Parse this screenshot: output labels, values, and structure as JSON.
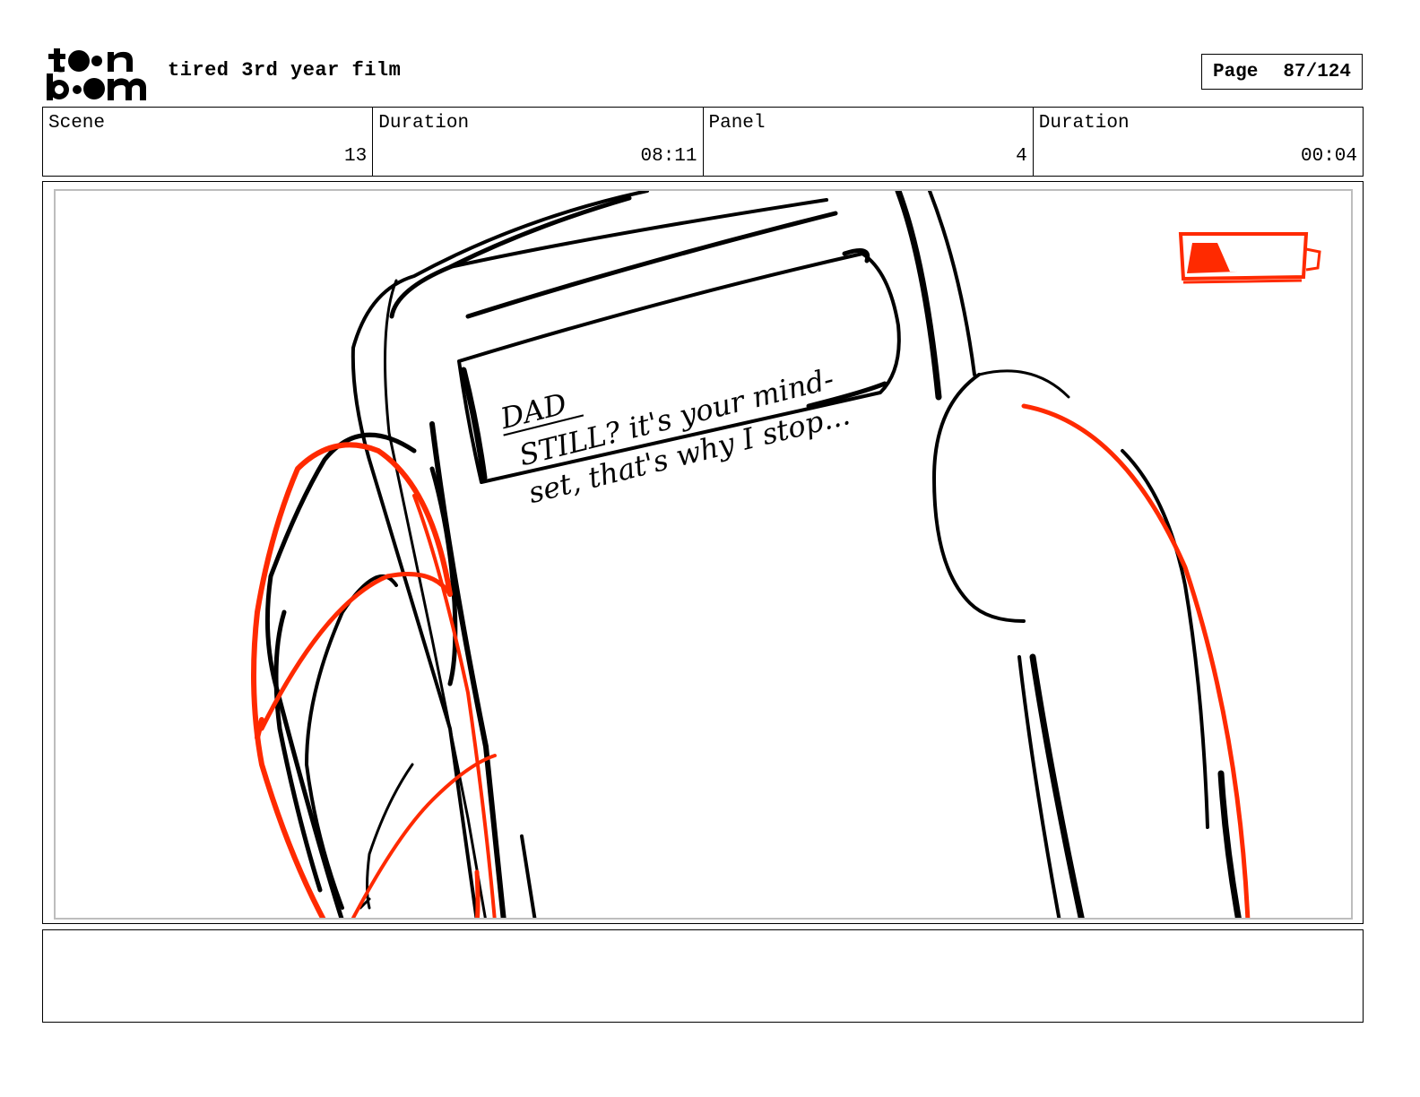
{
  "header": {
    "logo_text": "toon boom",
    "film_title": "tired 3rd year film",
    "page_label": "Page",
    "page_value": "87/124"
  },
  "info": {
    "scene_label": "Scene",
    "scene_value": "13",
    "scene_duration_label": "Duration",
    "scene_duration_value": "08:11",
    "panel_label": "Panel",
    "panel_value": "4",
    "panel_duration_label": "Duration",
    "panel_duration_value": "00:04"
  },
  "panel": {
    "phone_screen_text": [
      "DAD",
      "STILL? it's your mind-",
      "set, that's why I stop..."
    ],
    "battery_level": 0.25
  },
  "notes": {
    "text": ""
  },
  "colors": {
    "sketch_line": "#000000",
    "accent_red": "#ff2a00",
    "inner_border": "#bdbdbd"
  }
}
